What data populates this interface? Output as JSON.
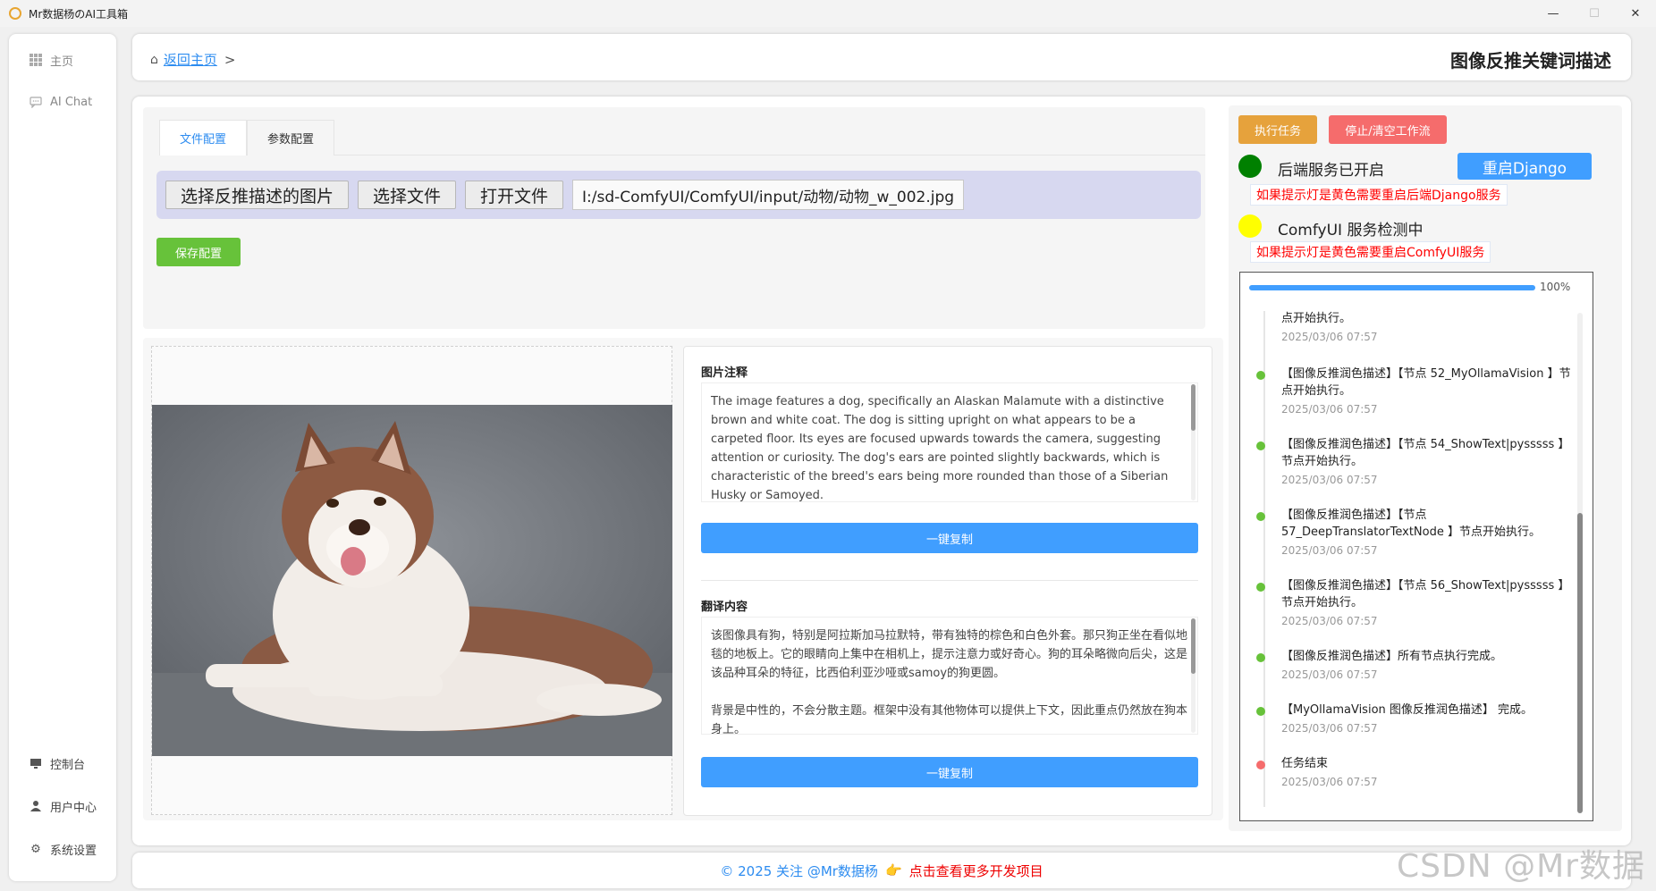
{
  "window": {
    "title": "Mr数据杨のAI工具箱",
    "minimize": "—",
    "maximize": "☐",
    "close": "✕"
  },
  "sidebar": {
    "items": [
      {
        "label": "主页",
        "icon": "grid-icon"
      },
      {
        "label": "AI Chat",
        "icon": "chat-icon"
      }
    ],
    "bottom_items": [
      {
        "label": "控制台",
        "icon": "monitor-icon"
      },
      {
        "label": "用户中心",
        "icon": "user-icon"
      },
      {
        "label": "系统设置",
        "icon": "gear-icon"
      }
    ]
  },
  "header": {
    "back_link": "返回主页",
    "separator": ">",
    "page_title": "图像反推关键词描述"
  },
  "config": {
    "tabs": [
      "文件配置",
      "参数配置"
    ],
    "active_tab": 0,
    "select_image_button": "选择反推描述的图片",
    "select_file_button": "选择文件",
    "open_file_button": "打开文件",
    "file_path": "I:/sd-ComfyUI/ComfyUI/input/动物/动物_w_002.jpg",
    "save_button": "保存配置"
  },
  "caption": {
    "title": "图片注释",
    "text": "The image features a dog, specifically an Alaskan Malamute with a distinctive brown and white coat. The dog is sitting upright on what appears to be a carpeted floor. Its eyes are focused upwards towards the camera, suggesting attention or curiosity. The dog's ears are pointed slightly backwards, which is characteristic of the breed's ears being more rounded than those of a Siberian Husky or Samoyed.",
    "copy_button": "一键复制"
  },
  "translation": {
    "title": "翻译内容",
    "paragraph1": "该图像具有狗，特别是阿拉斯加马拉默特，带有独特的棕色和白色外套。那只狗正坐在看似地毯的地板上。它的眼睛向上集中在相机上，提示注意力或好奇心。狗的耳朵略微向后尖，这是该品种耳朵的特征，比西伯利亚沙哑或samoy的狗更圆。",
    "paragraph2": "背景是中性的，不会分散主题。框架中没有其他物体可以提供上下文，因此重点仍然放在狗本身上。",
    "copy_button": "一键复制"
  },
  "control": {
    "run_button": "执行任务",
    "stop_button": "停止/清空工作流",
    "backend_status": "后端服务已开启",
    "backend_color": "#008000",
    "restart_button": "重启Django",
    "backend_hint": "如果提示灯是黄色需要重启后端Django服务",
    "comfy_status": "ComfyUI 服务检测中",
    "comfy_color": "#ffff00",
    "comfy_hint": "如果提示灯是黄色需要重启ComfyUI服务"
  },
  "progress": {
    "value": 1.0,
    "label": "100%"
  },
  "log": [
    {
      "msg": "点开始执行。",
      "time": "2025/03/06 07:57",
      "dot": "none"
    },
    {
      "msg": "【图像反推润色描述】【节点 52_MyOllamaVision 】节点开始执行。",
      "time": "2025/03/06 07:57",
      "dot": "#67c23a"
    },
    {
      "msg": "【图像反推润色描述】【节点 54_ShowText|pysssss 】节点开始执行。",
      "time": "2025/03/06 07:57",
      "dot": "#67c23a"
    },
    {
      "msg": "【图像反推润色描述】【节点 57_DeepTranslatorTextNode 】节点开始执行。",
      "time": "2025/03/06 07:57",
      "dot": "#67c23a"
    },
    {
      "msg": "【图像反推润色描述】【节点 56_ShowText|pysssss 】节点开始执行。",
      "time": "2025/03/06 07:57",
      "dot": "#67c23a"
    },
    {
      "msg": "【图像反推润色描述】所有节点执行完成。",
      "time": "2025/03/06 07:57",
      "dot": "#67c23a"
    },
    {
      "msg": "【MyOllamaVision 图像反推润色描述】 完成。",
      "time": "2025/03/06 07:57",
      "dot": "#67c23a"
    },
    {
      "msg": "任务结束",
      "time": "2025/03/06 07:57",
      "dot": "#f56c6c"
    }
  ],
  "footer": {
    "copyright": "© 2025 关注 @Mr数据杨",
    "hand": "👉",
    "more_link": "点击查看更多开发项目"
  },
  "watermark": "CSDN @Mr数据杨"
}
